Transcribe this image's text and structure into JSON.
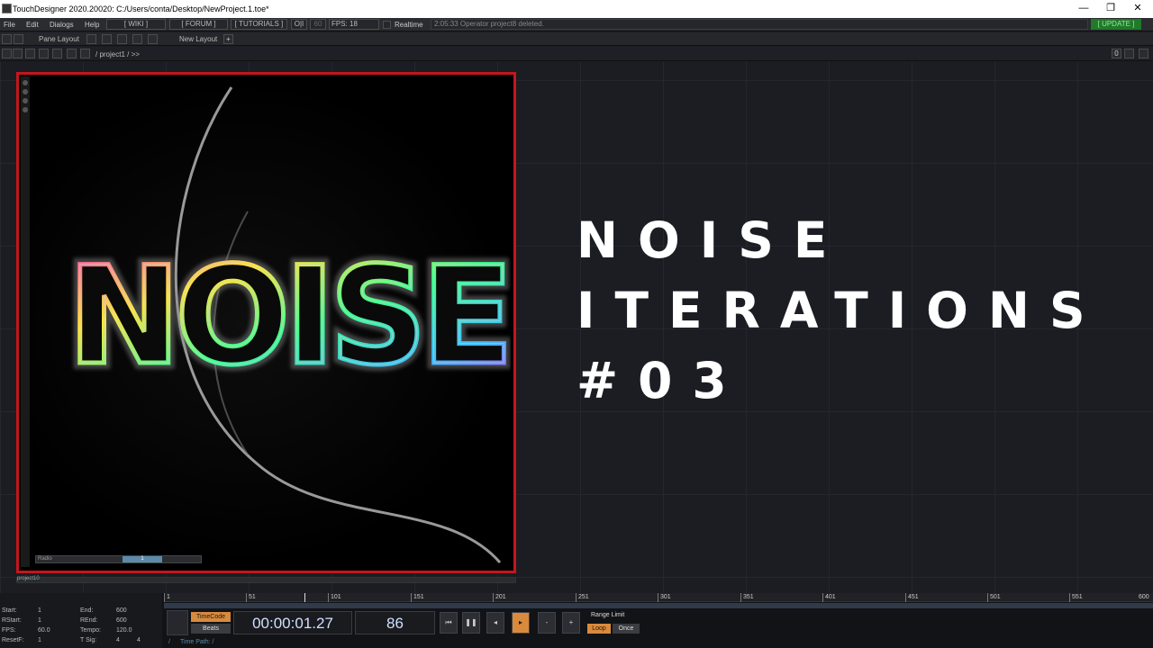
{
  "window": {
    "title": "TouchDesigner 2020.20020: C:/Users/conta/Desktop/NewProject.1.toe*",
    "min_glyph": "—",
    "restore_glyph": "❐",
    "close_glyph": "✕"
  },
  "menu": {
    "file": "File",
    "edit": "Edit",
    "dialogs": "Dialogs",
    "help": "Help",
    "wiki": "[ WIKI ]",
    "forum": "[ FORUM ]",
    "tutorials": "[ TUTORIALS ]",
    "oi": "O|I",
    "sixty": "60",
    "fps": "FPS: 18",
    "realtime": "Realtime",
    "status_message": "2:05:33 Operator project8 deleted.",
    "update": "[ UPDATE ]"
  },
  "pane": {
    "pane_layout": "Pane Layout",
    "new_layout": "New Layout",
    "plus": "+"
  },
  "path": {
    "crumb": "/ project1 / >>",
    "zero": "0"
  },
  "operator": {
    "name": "project10",
    "footer_label": "Radio",
    "slider_value": "1"
  },
  "overlay": {
    "line1": "NOISE",
    "line2": "ITERATIONS",
    "line3": "#03"
  },
  "timeline": {
    "ticks": [
      "1",
      "51",
      "101",
      "151",
      "201",
      "251",
      "301",
      "351",
      "401",
      "451",
      "501",
      "551",
      "600"
    ],
    "timecode": "00:00:01.27",
    "frame": "86",
    "timecode_toggle": "TimeCode",
    "beats_toggle": "Beats",
    "range_limit": "Range Limit",
    "loop": "Loop",
    "once": "Once",
    "time_path": "Time Path: /",
    "slash": "/",
    "minus": "-",
    "plus": "+",
    "params": {
      "start_label": "Start:",
      "start": "1",
      "rstart_label": "RStart:",
      "rstart": "1",
      "fps_label": "FPS:",
      "fps": "60.0",
      "resetf_label": "ResetF:",
      "resetf": "1",
      "end_label": "End:",
      "end": "600",
      "rend_label": "REnd:",
      "rend": "600",
      "tempo_label": "Tempo:",
      "tempo": "120.0",
      "tsig_label": "T Sig:",
      "tsig_a": "4",
      "tsig_b": "4"
    }
  }
}
